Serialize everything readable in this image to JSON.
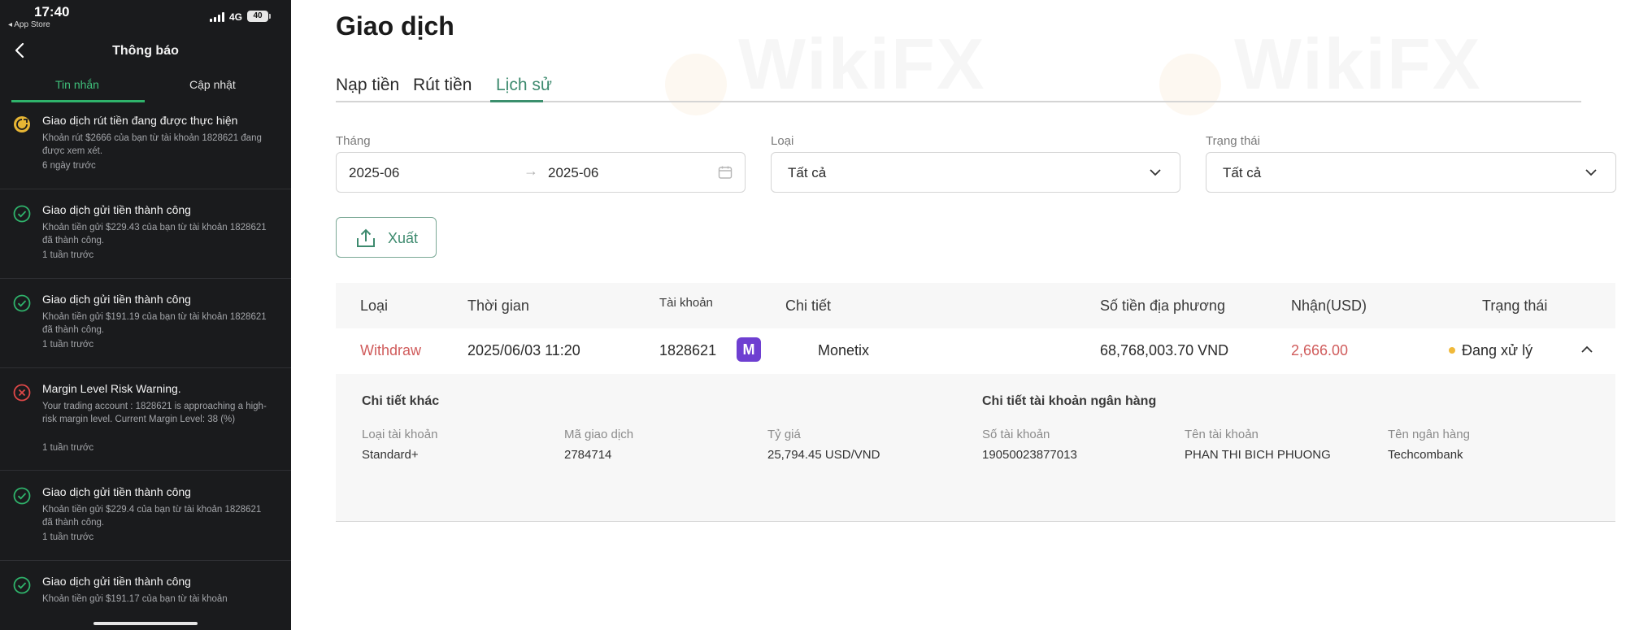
{
  "status_bar": {
    "time": "17:40",
    "back_app": "◂ App Store",
    "network": "4G",
    "battery": "40"
  },
  "phone": {
    "nav_title": "Thông báo",
    "tabs": [
      {
        "label": "Tin nhắn",
        "active": true
      },
      {
        "label": "Cập nhật",
        "active": false
      }
    ],
    "notifications": [
      {
        "icon": "pending-withdraw-icon",
        "title": "Giao dịch rút tiền đang được thực hiện",
        "body": "Khoản rút $2666 của bạn từ tài khoản 1828621 đang được xem xét.",
        "time": "6 ngày trước"
      },
      {
        "icon": "success-check-icon",
        "title": "Giao dịch gửi tiền thành công",
        "body": "Khoản tiền gửi $229.43 của bạn từ tài khoản 1828621 đã thành công.",
        "time": "1 tuần trước"
      },
      {
        "icon": "success-check-icon",
        "title": "Giao dịch gửi tiền thành công",
        "body": "Khoản tiền gửi $191.19 của bạn từ tài khoản 1828621 đã thành công.",
        "time": "1 tuần trước"
      },
      {
        "icon": "warning-x-icon",
        "title": "Margin Level Risk Warning.",
        "body": "Your trading account : 1828621 is approaching a high-risk margin level. Current Margin Level: 38 (%)",
        "time": "1 tuần trước"
      },
      {
        "icon": "success-check-icon",
        "title": "Giao dịch gửi tiền thành công",
        "body": "Khoản tiền gửi $229.4 của bạn từ tài khoản 1828621 đã thành công.",
        "time": "1 tuần trước"
      },
      {
        "icon": "success-check-icon",
        "title": "Giao dịch gửi tiền thành công",
        "body": "Khoản tiền gửi $191.17 của bạn từ tài khoản",
        "time": ""
      }
    ]
  },
  "main": {
    "title": "Giao dịch",
    "tabs": [
      {
        "label": "Nạp tiền",
        "active": false
      },
      {
        "label": "Rút tiền",
        "active": false
      },
      {
        "label": "Lịch sử",
        "active": true
      }
    ],
    "filters": {
      "month_label": "Tháng",
      "month_from": "2025-06",
      "month_to": "2025-06",
      "range_arrow": "→",
      "type_label": "Loại",
      "type_value": "Tất cả",
      "status_label": "Trạng thái",
      "status_value": "Tất cả"
    },
    "export_label": "Xuất",
    "table": {
      "headers": [
        "Loại",
        "Thời gian",
        "Tài khoản",
        "Chi tiết",
        "Số tiền địa phương",
        "Nhận(USD)",
        "Trạng thái"
      ],
      "row": {
        "type": "Withdraw",
        "time": "2025/06/03 11:20",
        "account": "1828621",
        "detail_logo": "M",
        "detail": "Monetix",
        "local_amount": "68,768,003.70 VND",
        "received_usd": "2,666.00",
        "status": "Đang xử lý"
      }
    },
    "detail": {
      "other_title": "Chi tiết khác",
      "bank_title": "Chi tiết tài khoản ngân hàng",
      "fields": [
        {
          "label": "Loại tài khoản",
          "value": "Standard+"
        },
        {
          "label": "Mã giao dịch",
          "value": "2784714"
        },
        {
          "label": "Tỷ giá",
          "value": "25,794.45 USD/VND"
        },
        {
          "label": "Số tài khoản",
          "value": "19050023877013"
        },
        {
          "label": "Tên tài khoản",
          "value": "PHAN THI BICH PHUONG"
        },
        {
          "label": "Tên ngân hàng",
          "value": "Techcombank"
        }
      ]
    },
    "watermark": "WikiFX"
  },
  "colors": {
    "accent_green": "#3d8a6e",
    "phone_bg": "#1a1b1d",
    "withdraw_red": "#d05c5c",
    "pending_yellow": "#f0b93a",
    "success_green": "#2fb36b",
    "warning_red": "#e04848"
  }
}
